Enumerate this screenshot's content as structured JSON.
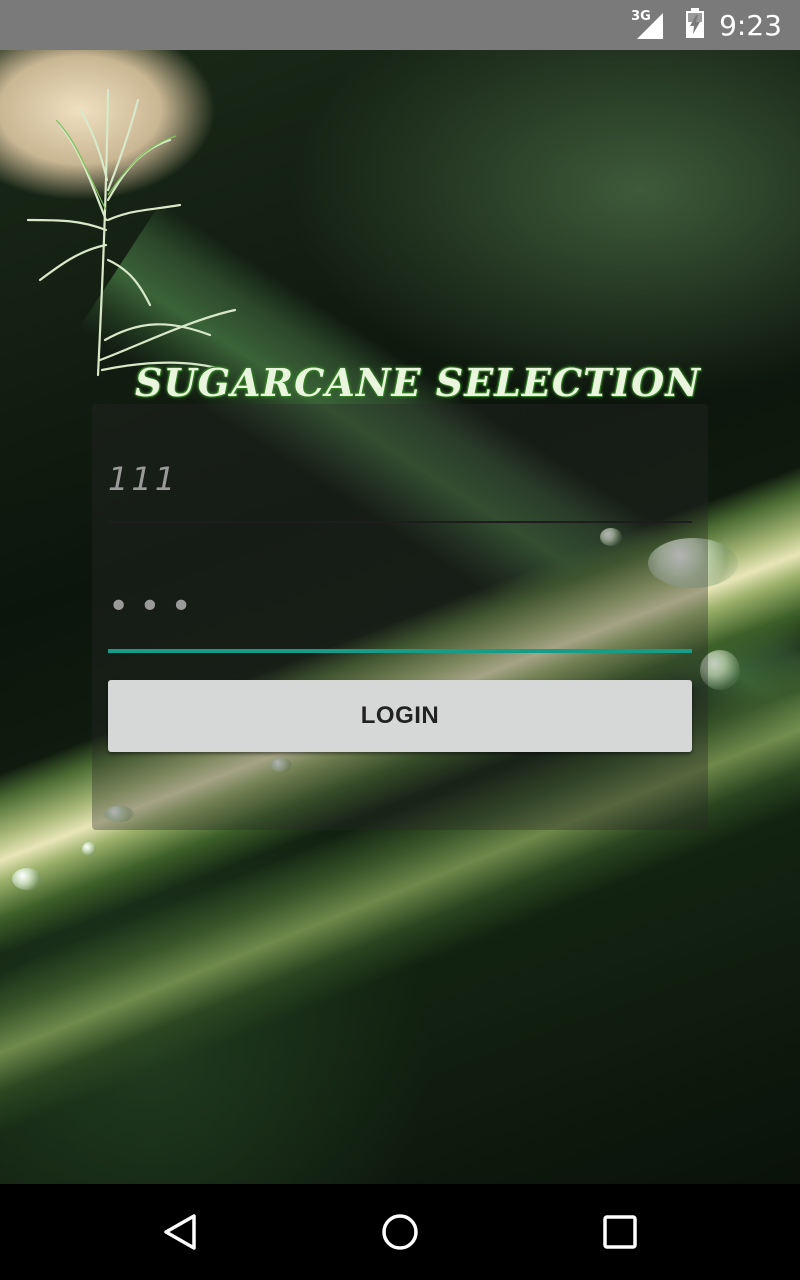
{
  "status_bar": {
    "network_label": "3G",
    "time": "9:23",
    "icons": [
      "signal-icon",
      "battery-charging-icon"
    ]
  },
  "app": {
    "title": "SUGARCANE SELECTION",
    "logo_icon": "sugarcane-plant-icon"
  },
  "login": {
    "username_value": "111",
    "password_value": "•••",
    "button_label": "LOGIN"
  },
  "colors": {
    "accent": "#179c8a",
    "button_bg": "#d6d7d7",
    "status_bar_bg": "#7a7a7a"
  },
  "nav_bar": {
    "icons": [
      "back-icon",
      "home-icon",
      "recent-apps-icon"
    ]
  }
}
